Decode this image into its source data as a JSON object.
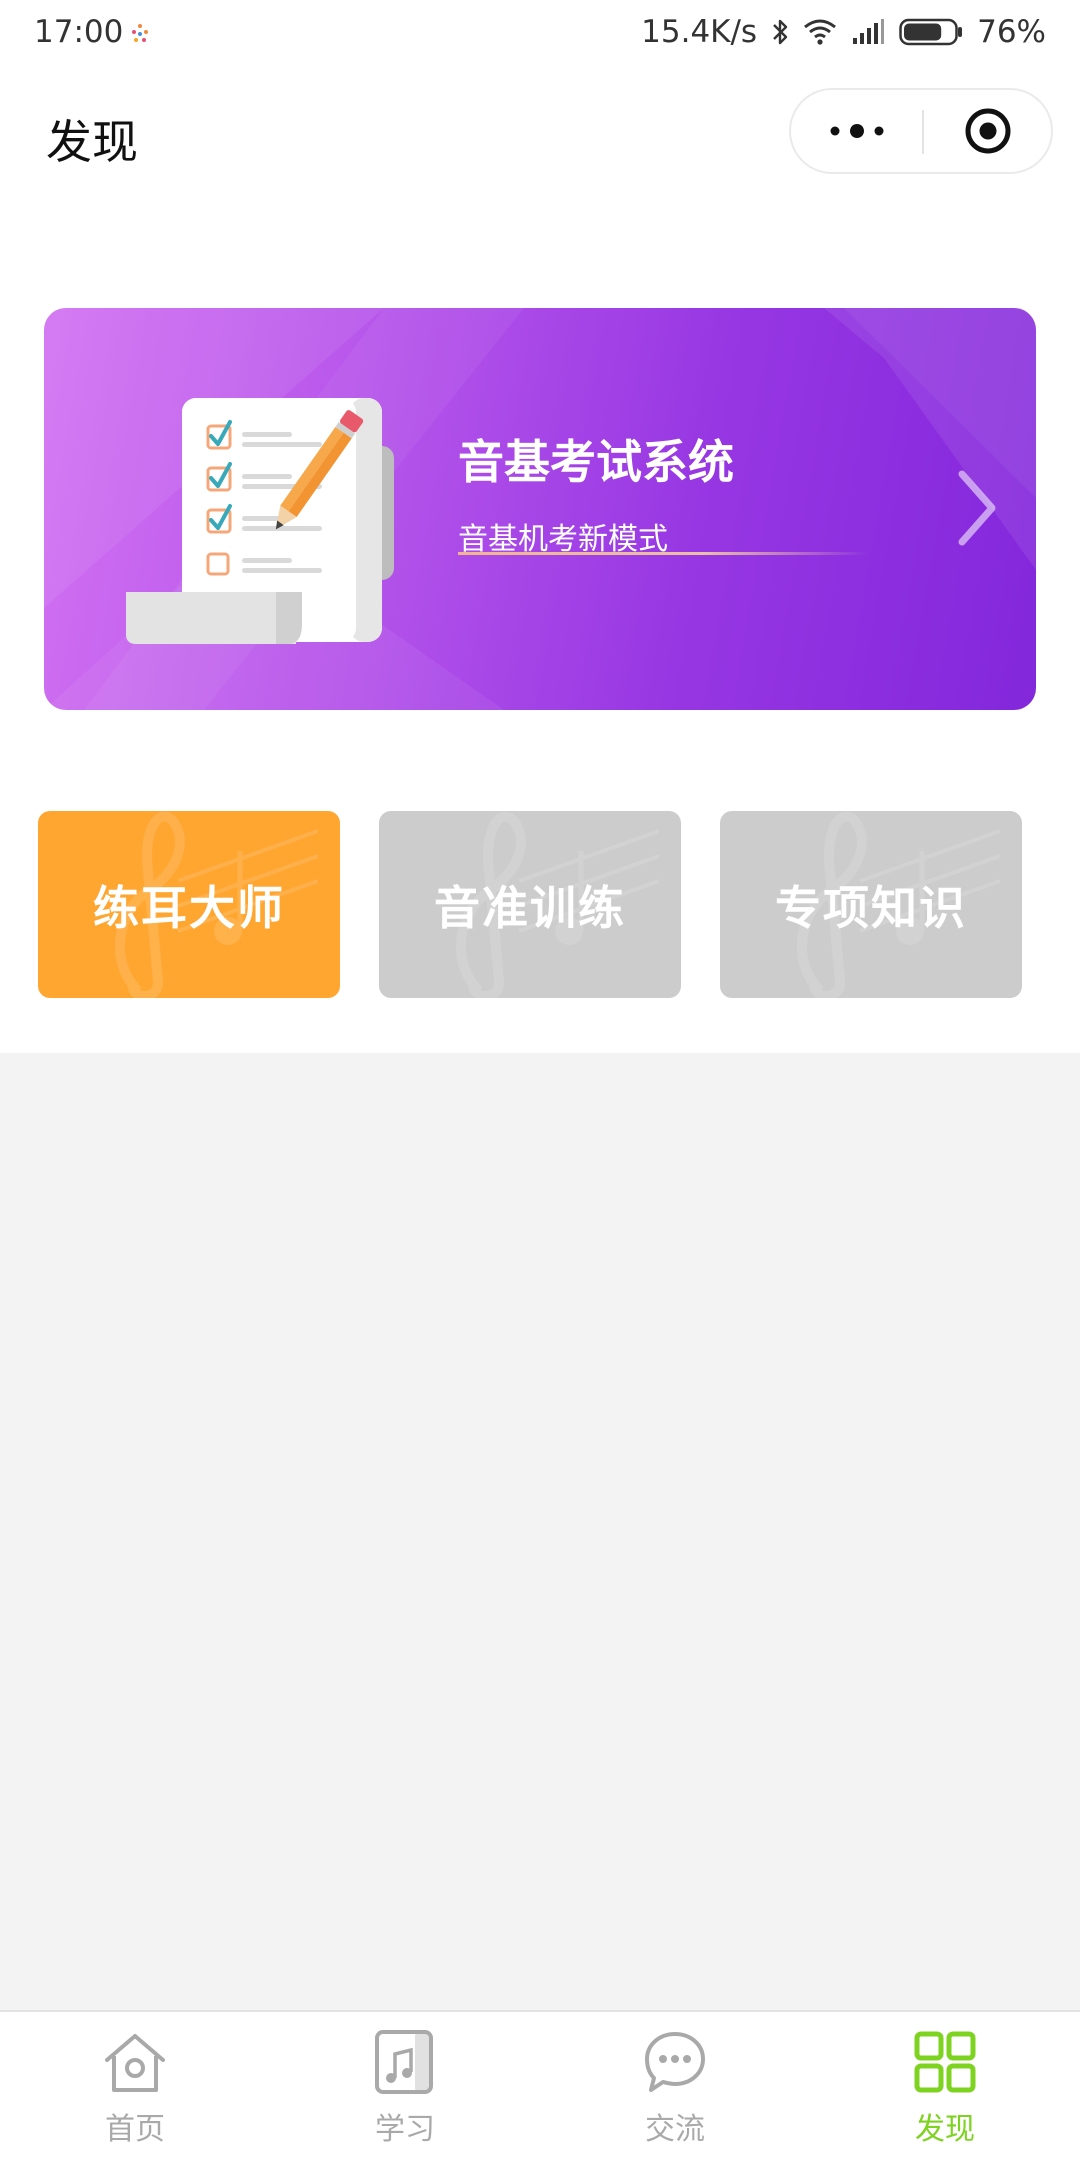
{
  "status_bar": {
    "time": "17:00",
    "network_speed": "15.4K/s",
    "battery_percent": "76%",
    "battery_level": 0.76,
    "icons": [
      "bluetooth-icon",
      "wifi-icon",
      "signal-icon",
      "battery-icon"
    ]
  },
  "header": {
    "title": "发现",
    "more_icon": "more-dots-icon",
    "close_icon": "target-close-icon"
  },
  "banner": {
    "title": "音基考试系统",
    "subtitle": "音基机考新模式",
    "illustration": "checklist-pencil-illustration",
    "arrow_icon": "chevron-right-icon",
    "colors": {
      "start": "#d271f2",
      "end": "#8327dc"
    }
  },
  "categories": [
    {
      "label": "练耳大师",
      "color": "#ffa631",
      "active": true
    },
    {
      "label": "音准训练",
      "color": "#cccccc",
      "active": false
    },
    {
      "label": "专项知识",
      "color": "#cccccc",
      "active": false
    }
  ],
  "tab_bar": {
    "items": [
      {
        "label": "首页",
        "icon": "home-icon",
        "active": false
      },
      {
        "label": "学习",
        "icon": "music-book-icon",
        "active": false
      },
      {
        "label": "交流",
        "icon": "chat-bubble-icon",
        "active": false
      },
      {
        "label": "发现",
        "icon": "grid-icon",
        "active": true
      }
    ],
    "active_color": "#7ed321",
    "inactive_color": "#a9a9a9"
  }
}
